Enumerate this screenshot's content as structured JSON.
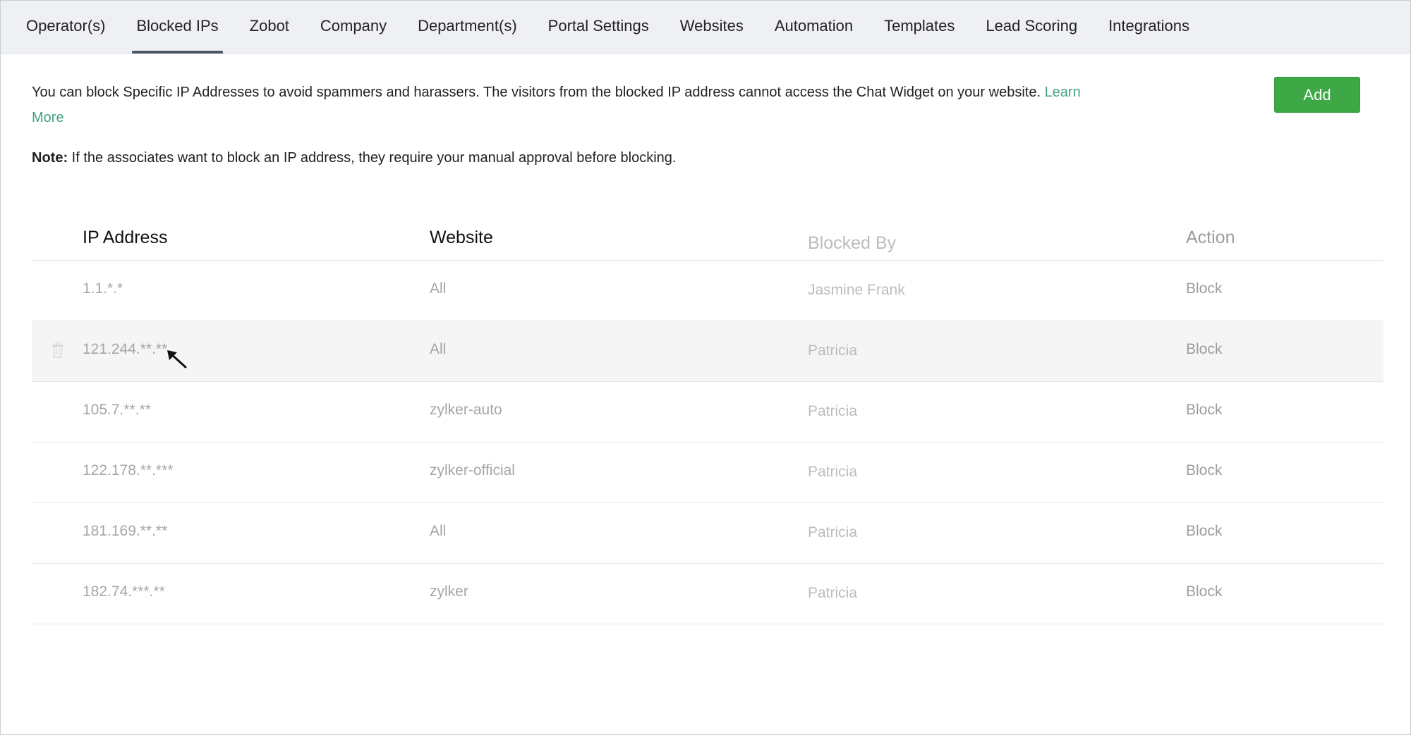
{
  "nav": {
    "tabs": [
      {
        "label": "Operator(s)",
        "active": false
      },
      {
        "label": "Blocked IPs",
        "active": true
      },
      {
        "label": "Zobot",
        "active": false
      },
      {
        "label": "Company",
        "active": false
      },
      {
        "label": "Department(s)",
        "active": false
      },
      {
        "label": "Portal Settings",
        "active": false
      },
      {
        "label": "Websites",
        "active": false
      },
      {
        "label": "Automation",
        "active": false
      },
      {
        "label": "Templates",
        "active": false
      },
      {
        "label": "Lead Scoring",
        "active": false
      },
      {
        "label": "Integrations",
        "active": false
      }
    ]
  },
  "description": {
    "text": "You can block Specific IP Addresses to avoid spammers and harassers. The visitors from the blocked IP address cannot access the Chat Widget on your website.",
    "link": "Learn More"
  },
  "note": {
    "label": "Note:",
    "text": " If the associates want to block an IP address, they require your manual approval before blocking."
  },
  "add_button": "Add",
  "table": {
    "headers": {
      "ip": "IP Address",
      "website": "Website",
      "blocked_by": "Blocked By",
      "action": "Action"
    },
    "rows": [
      {
        "ip": "1.1.*.*",
        "website": "All",
        "blocked_by": "Jasmine Frank",
        "action": "Block"
      },
      {
        "ip": "121.244.**.**",
        "website": "All",
        "blocked_by": "Patricia",
        "action": "Block"
      },
      {
        "ip": "105.7.**.**",
        "website": "zylker-auto",
        "blocked_by": "Patricia",
        "action": "Block"
      },
      {
        "ip": "122.178.**.***",
        "website": "zylker-official",
        "blocked_by": "Patricia",
        "action": "Block"
      },
      {
        "ip": "181.169.**.**",
        "website": "All",
        "blocked_by": "Patricia",
        "action": "Block"
      },
      {
        "ip": "182.74.***.**",
        "website": "zylker",
        "blocked_by": "Patricia",
        "action": "Block"
      }
    ]
  },
  "colors": {
    "accent_green": "#3da845",
    "link_green": "#44a27f",
    "nav_bg": "#eef0f3"
  }
}
